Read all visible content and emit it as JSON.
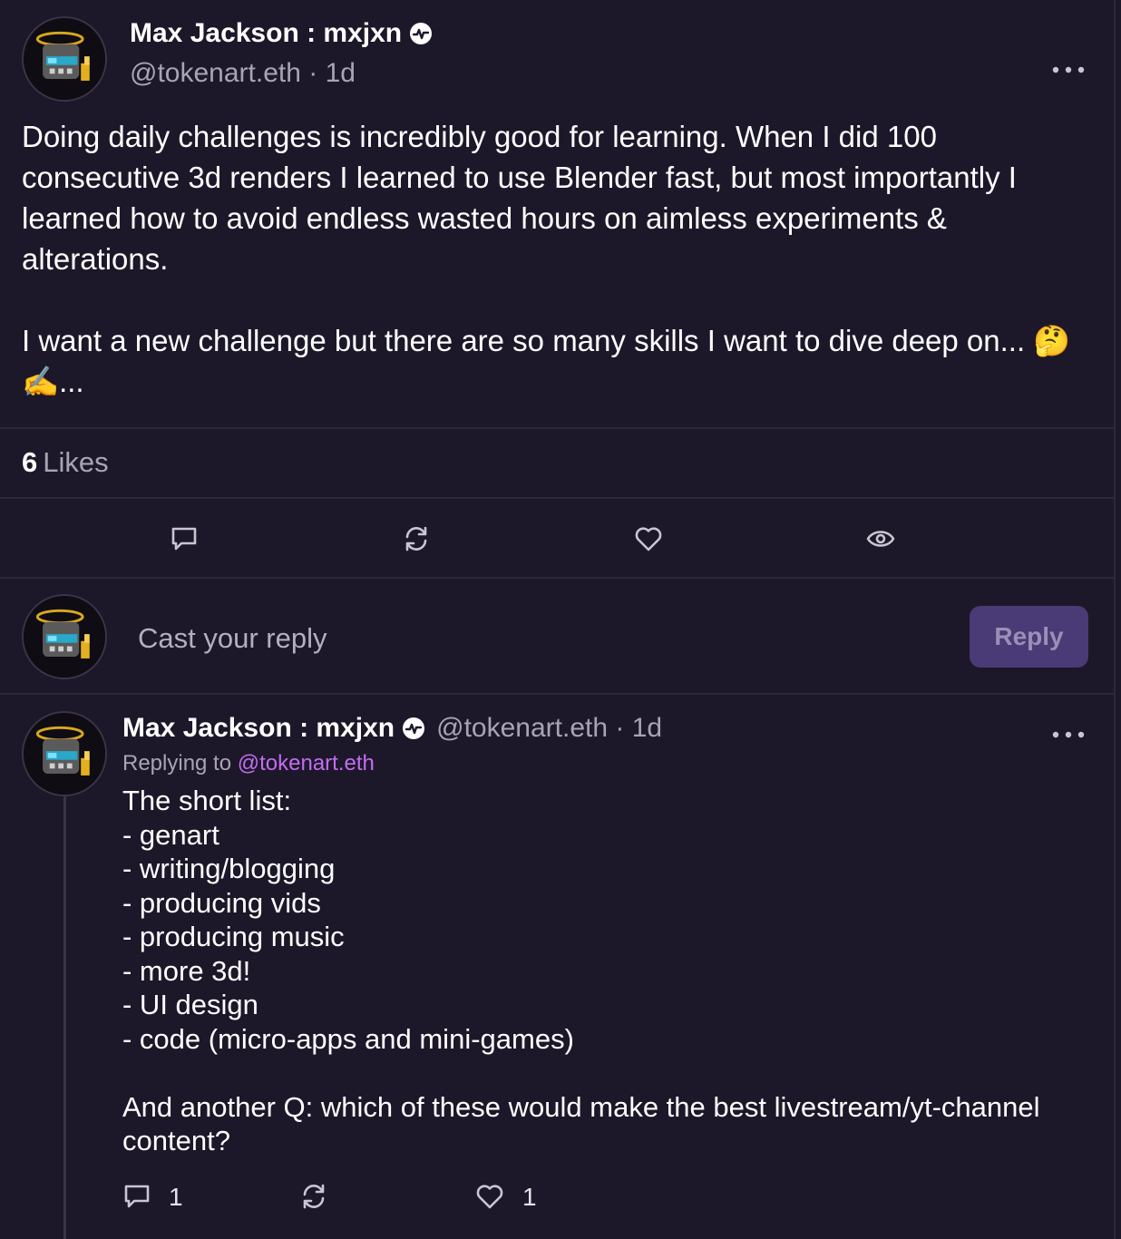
{
  "cast": {
    "author": {
      "display_name": "Max Jackson : mxjxn",
      "handle": "@tokenart.eth",
      "time": "1d"
    },
    "text": "Doing daily challenges is incredibly good for learning. When I did 100 consecutive 3d renders I learned to use Blender fast, but most importantly I learned how to avoid endless wasted hours on aimless experiments & alterations.\n\nI want a new challenge but there are so many skills I want to dive deep on... 🤔✍️...",
    "likes_count": "6",
    "likes_label": "Likes",
    "actions": [
      "comment-icon",
      "recast-icon",
      "heart-icon",
      "eye-icon"
    ]
  },
  "composer": {
    "placeholder": "Cast your reply",
    "reply_button": "Reply"
  },
  "reply": {
    "author": {
      "display_name": "Max Jackson : mxjxn",
      "handle": "@tokenart.eth",
      "time": "1d"
    },
    "replying_to_label": "Replying to",
    "replying_to_handle": "@tokenart.eth",
    "text": "The short list:\n- genart\n- writing/blogging\n- producing vids\n- producing music\n- more 3d!\n- UI design\n- code (micro-apps and mini-games)\n\nAnd another Q: which of these would make the best livestream/yt-channel content?",
    "comments_count": "1",
    "likes_count": "1"
  },
  "colors": {
    "background": "#1c1829",
    "divider": "#2d2838",
    "muted_text": "#a9a4b4",
    "accent_link": "#c36cf2",
    "reply_button_bg": "#4a3a76"
  }
}
